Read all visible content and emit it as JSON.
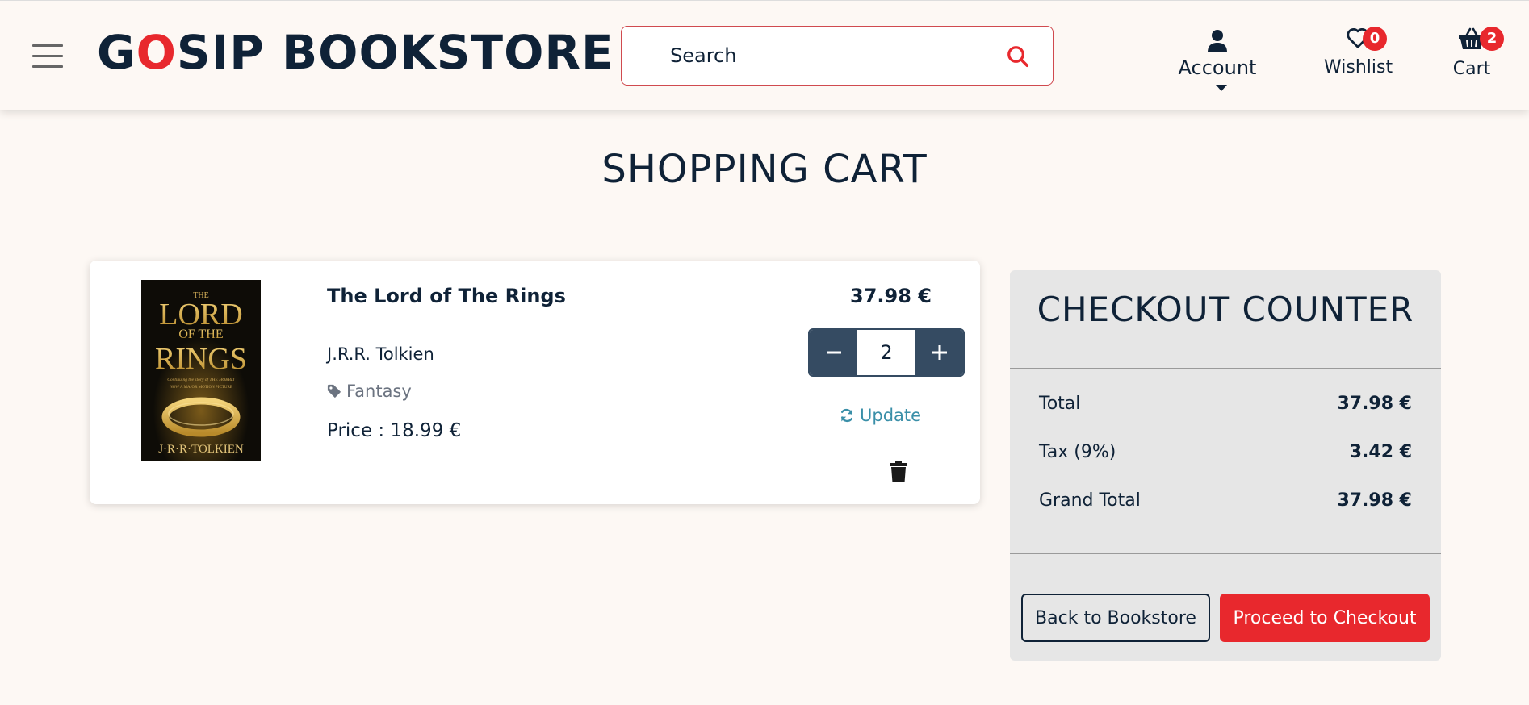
{
  "header": {
    "logo": {
      "part1": "G",
      "part2": "O",
      "part3": "SIP BOOKSTORE"
    },
    "search": {
      "placeholder": "Search"
    },
    "account_label": "Account",
    "wishlist": {
      "label": "Wishlist",
      "count": "0"
    },
    "cart": {
      "label": "Cart",
      "count": "2"
    }
  },
  "page": {
    "title": "SHOPPING CART"
  },
  "cart_items": [
    {
      "title": "The Lord of The Rings",
      "author": "J.R.R. Tolkien",
      "genre": "Fantasy",
      "price": "Price : 18.99 €",
      "quantity": "2",
      "line_total": "37.98 €",
      "update_label": "Update",
      "cover": {
        "top": "THE",
        "main1": "LORD",
        "main2": "OF THE",
        "main3": "RINGS",
        "tagline": "Continuing the story of THE HOBBIT",
        "tagline2": "NOW A MAJOR MOTION PICTURE",
        "author": "J·R·R·TOLKIEN"
      }
    }
  ],
  "checkout": {
    "title": "CHECKOUT COUNTER",
    "rows": [
      {
        "label": "Total",
        "value": "37.98 €"
      },
      {
        "label": "Tax (9%)",
        "value": "3.42 €"
      },
      {
        "label": "Grand Total",
        "value": "37.98 €"
      }
    ],
    "back_label": "Back to Bookstore",
    "proceed_label": "Proceed to Checkout"
  },
  "colors": {
    "accent": "#e8282d",
    "navy": "#0f2237",
    "stepper": "#354b62",
    "link": "#3a8fa8",
    "panel": "#e6e6e6"
  }
}
